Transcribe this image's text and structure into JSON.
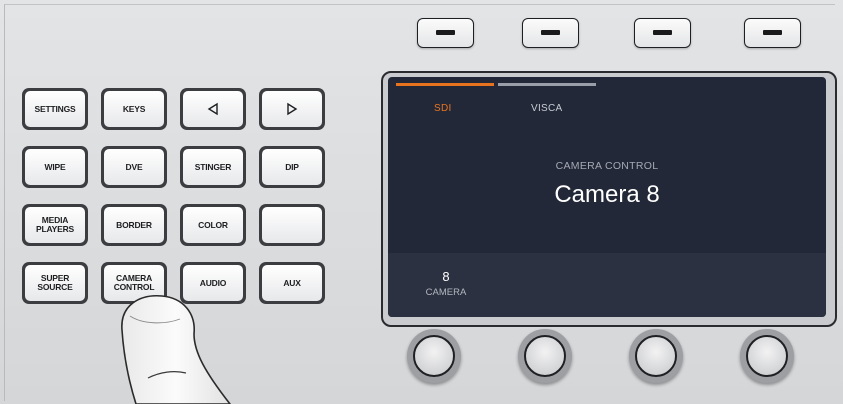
{
  "buttons": {
    "settings": "SETTINGS",
    "keys": "KEYS",
    "arrow_left": "◁",
    "arrow_right": "▷",
    "wipe": "WIPE",
    "dve": "DVE",
    "stinger": "STINGER",
    "dip": "DIP",
    "media_players": "MEDIA\nPLAYERS",
    "border": "BORDER",
    "color": "COLOR",
    "blank": "",
    "super_source": "SUPER\nSOURCE",
    "camera_control": "CAMERA\nCONTROL",
    "audio": "AUDIO",
    "aux": "AUX"
  },
  "display": {
    "tabs": [
      {
        "label": "SDI",
        "active": true
      },
      {
        "label": "VISCA",
        "active": false
      }
    ],
    "caption": "CAMERA CONTROL",
    "title": "Camera 8",
    "parameter": {
      "value": "8",
      "label": "CAMERA"
    }
  },
  "colors": {
    "accent_orange": "#e8731e",
    "inactive_tab": "#9a9ea8",
    "lcd_background": "#232838"
  },
  "icons": [
    "soft-key-dash-icon",
    "arrow-left-icon",
    "arrow-right-icon",
    "knob-icon"
  ]
}
